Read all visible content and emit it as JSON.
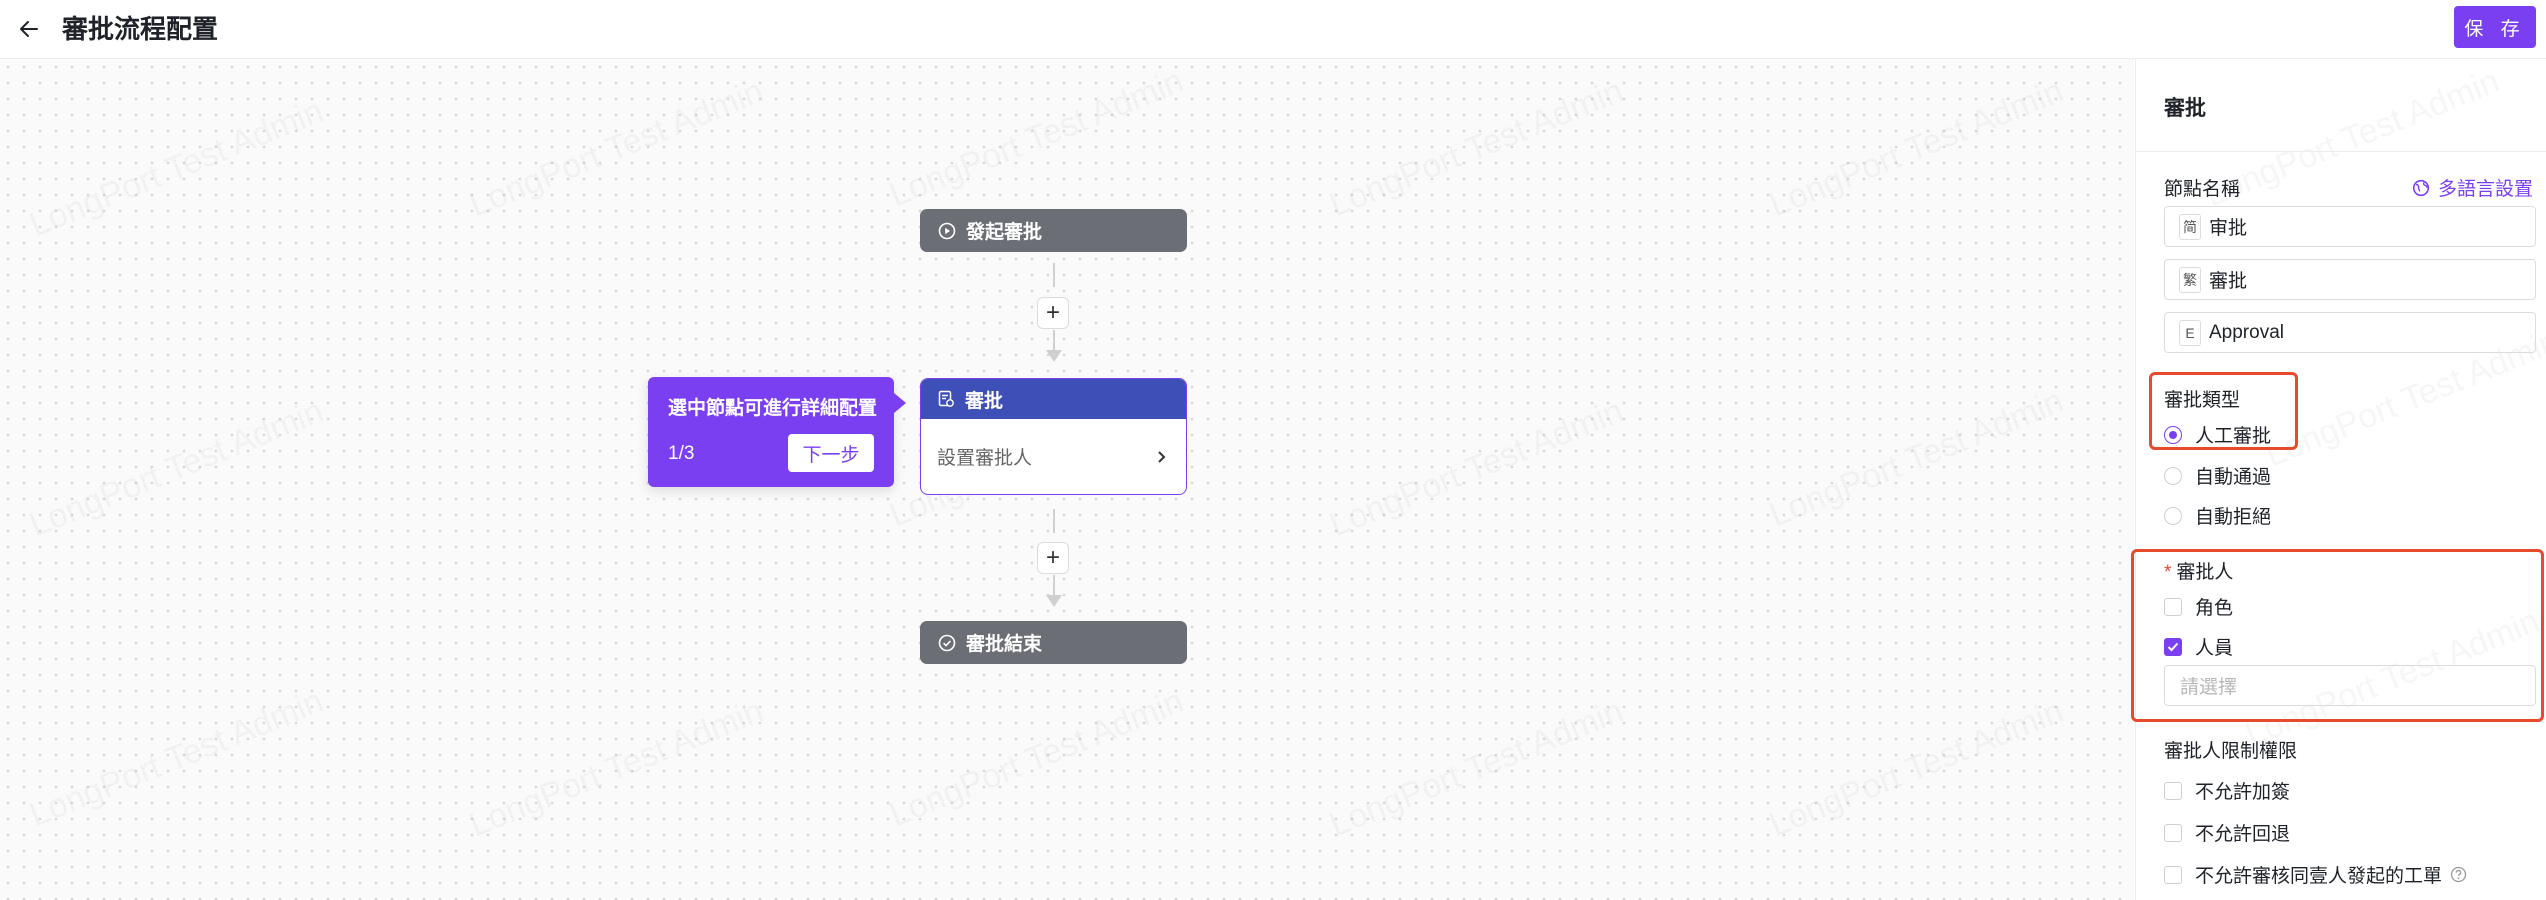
{
  "header": {
    "title": "審批流程配置",
    "save_label": "保 存"
  },
  "canvas": {
    "watermark": "LongPort Test Admin",
    "start_node": {
      "label": "發起審批"
    },
    "approve_node": {
      "title": "審批",
      "body": "設置審批人"
    },
    "end_node": {
      "label": "審批結束"
    },
    "plus_symbol": "+",
    "guide": {
      "text": "選中節點可進行詳細配置",
      "step": "1/3",
      "next_label": "下一步"
    }
  },
  "panel": {
    "title": "審批",
    "node_name_label": "節點名稱",
    "multilang_label": "多語言設置",
    "names": [
      {
        "tag": "简",
        "value": "审批"
      },
      {
        "tag": "繁",
        "value": "審批"
      },
      {
        "tag": "E",
        "value": "Approval"
      }
    ],
    "approval_type": {
      "label": "審批類型",
      "options": [
        "人工審批",
        "自動通過",
        "自動拒絕"
      ],
      "selected": "人工審批"
    },
    "approver": {
      "required_mark": "*",
      "label": "審批人",
      "options": [
        {
          "label": "角色",
          "checked": false
        },
        {
          "label": "人員",
          "checked": true
        }
      ],
      "select_placeholder": "請選擇"
    },
    "restrictions": {
      "label": "審批人限制權限",
      "options": [
        {
          "label": "不允許加簽",
          "checked": false
        },
        {
          "label": "不允許回退",
          "checked": false
        },
        {
          "label": "不允許審核同壹人發起的工單",
          "checked": false
        }
      ]
    }
  },
  "colors": {
    "accent": "#7b3ff2",
    "node_dark": "#6b6e74",
    "node_header": "#3f4fb8",
    "highlight_box": "#e84a2c"
  }
}
